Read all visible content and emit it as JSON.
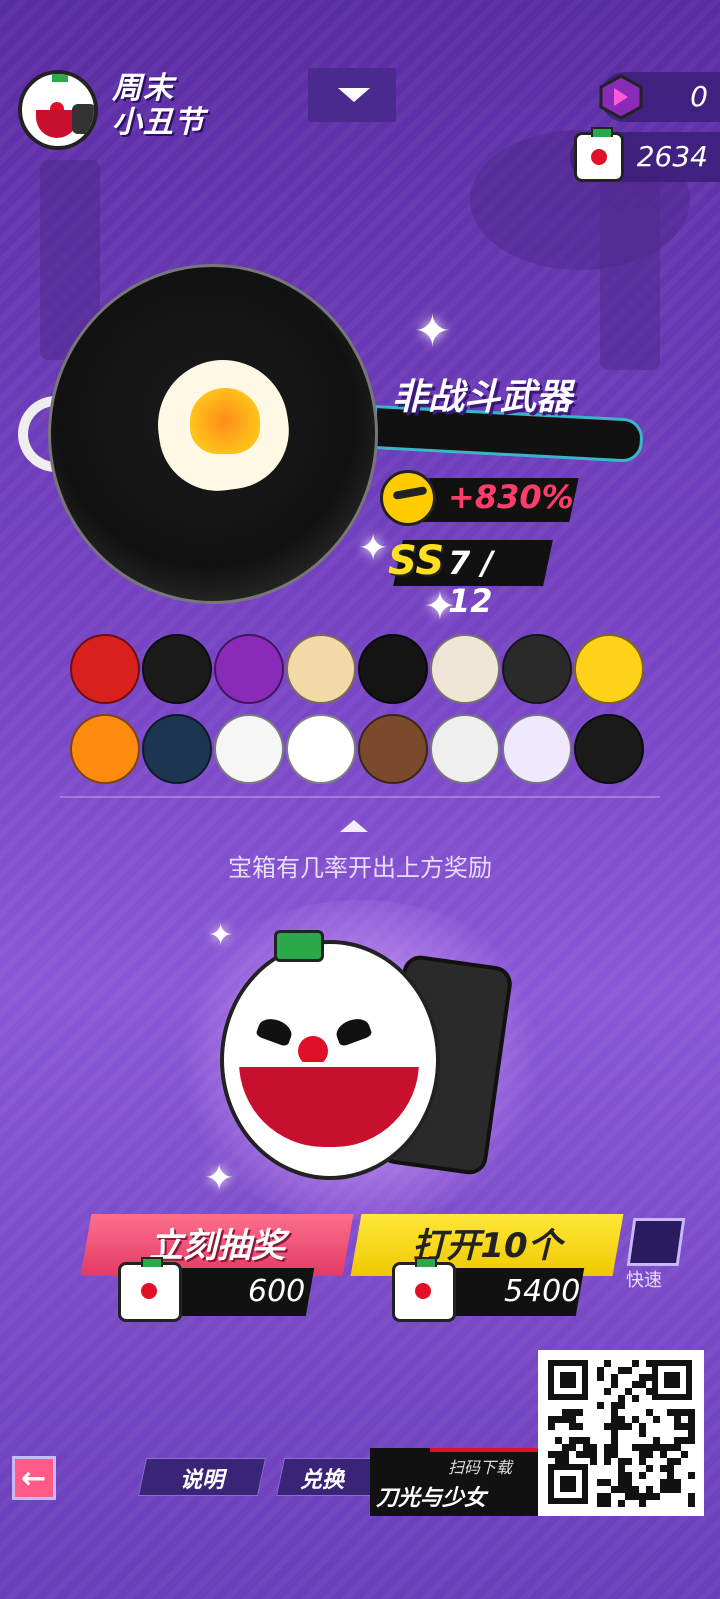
{
  "header": {
    "event_title_line1": "周末",
    "event_title_line2": "小丑节",
    "gems": "0",
    "boxes": "2634"
  },
  "item": {
    "type_label": "非战斗武器",
    "bonus": "+830%",
    "rarity": "SS",
    "rarity_count": "7 / 12"
  },
  "rewards": [
    {
      "name": "nutcracker-hat",
      "color": "#d8201e"
    },
    {
      "name": "black-bob-hair",
      "color": "#1a1a1a"
    },
    {
      "name": "purple-robot-helmet",
      "color": "#8a2ab8"
    },
    {
      "name": "blonde-twintails",
      "color": "#f3d9a8"
    },
    {
      "name": "black-rabbit-mask",
      "color": "#141414"
    },
    {
      "name": "goat-skull-mask",
      "color": "#efe6d8"
    },
    {
      "name": "orange-visor-helmet",
      "color": "#2a2a2a"
    },
    {
      "name": "lego-head",
      "color": "#ffd21a"
    },
    {
      "name": "pumpkin-head",
      "color": "#ff8a10"
    },
    {
      "name": "cyber-helmet",
      "color": "#1c3550"
    },
    {
      "name": "white-rabbit-head",
      "color": "#f6f6f6"
    },
    {
      "name": "clown-face",
      "color": "#ffffff"
    },
    {
      "name": "bear-head",
      "color": "#7a4a2a"
    },
    {
      "name": "box-head",
      "color": "#efefef"
    },
    {
      "name": "fish-head",
      "color": "#f0e8ff"
    },
    {
      "name": "grim-hood",
      "color": "#1a1a1a"
    }
  ],
  "hint_text": "宝箱有几率开出上方奖励",
  "actions": {
    "draw_now_label": "立刻抽奖",
    "draw_now_cost": "600",
    "open_ten_label": "打开10个",
    "open_ten_cost": "5400",
    "fast_label": "快速"
  },
  "footer": {
    "back_icon": "←",
    "info_label": "说明",
    "exchange_label": "兑换",
    "scan_label": "扫码下载",
    "brand_label": "刀光与少女"
  },
  "colors": {
    "accent_pink": "#e23a64",
    "accent_yellow": "#f0c800",
    "bg_purple": "#7a47c8"
  }
}
